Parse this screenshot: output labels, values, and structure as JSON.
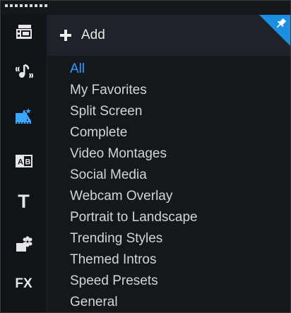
{
  "toolbar": {
    "add_label": "Add"
  },
  "rail": {
    "items": [
      {
        "icon": "media-library-icon"
      },
      {
        "icon": "music-notes-icon"
      },
      {
        "icon": "instant-project-icon",
        "active": true
      },
      {
        "icon": "title-ab-icon"
      },
      {
        "icon": "text-t-icon",
        "glyph": "T"
      },
      {
        "icon": "graphics-icon"
      },
      {
        "icon": "effects-fx-icon",
        "glyph": "FX"
      }
    ]
  },
  "categories": [
    {
      "label": "All",
      "selected": true
    },
    {
      "label": "My Favorites"
    },
    {
      "label": "Split Screen"
    },
    {
      "label": "Complete"
    },
    {
      "label": "Video Montages"
    },
    {
      "label": "Social Media"
    },
    {
      "label": "Webcam Overlay"
    },
    {
      "label": "Portrait to Landscape"
    },
    {
      "label": "Trending Styles"
    },
    {
      "label": "Themed Intros"
    },
    {
      "label": "Speed Presets"
    },
    {
      "label": "General"
    }
  ],
  "colors": {
    "accent": "#2f9bff",
    "pin_corner": "#1d8fe0",
    "active_icon": "#3aa7ff"
  }
}
